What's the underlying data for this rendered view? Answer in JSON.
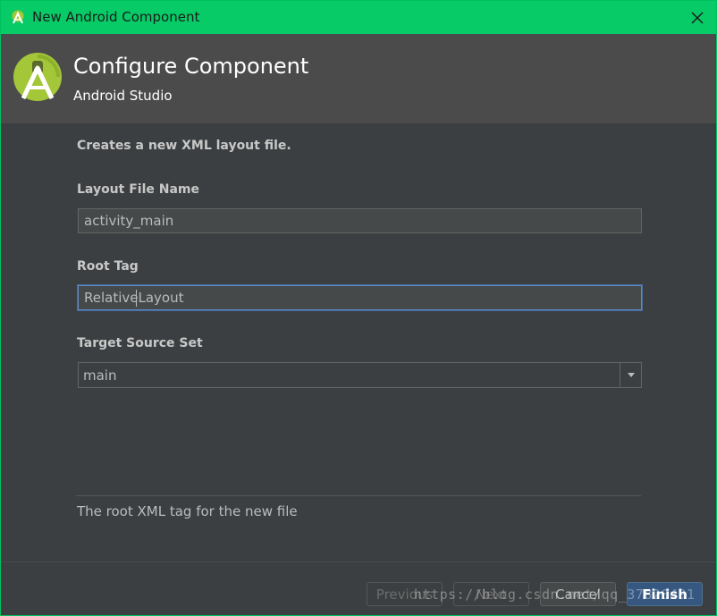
{
  "window": {
    "title": "New Android Component",
    "accent_color": "#07cb67"
  },
  "header": {
    "title": "Configure Component",
    "subtitle": "Android Studio",
    "logo_icon": "android-studio-logo-icon"
  },
  "form": {
    "description": "Creates a new XML layout file.",
    "layout_file_name": {
      "label": "Layout File Name",
      "value": "activity_main"
    },
    "root_tag": {
      "label": "Root Tag",
      "value": "RelativeLayout"
    },
    "target_source_set": {
      "label": "Target Source Set",
      "value": "main"
    },
    "help_text": "The root XML tag for the new file"
  },
  "buttons": {
    "previous": "Previous",
    "next": "Next",
    "cancel": "Cancel",
    "finish": "Finish"
  },
  "watermark": "https://blog.csdn.net/qq_37820491"
}
